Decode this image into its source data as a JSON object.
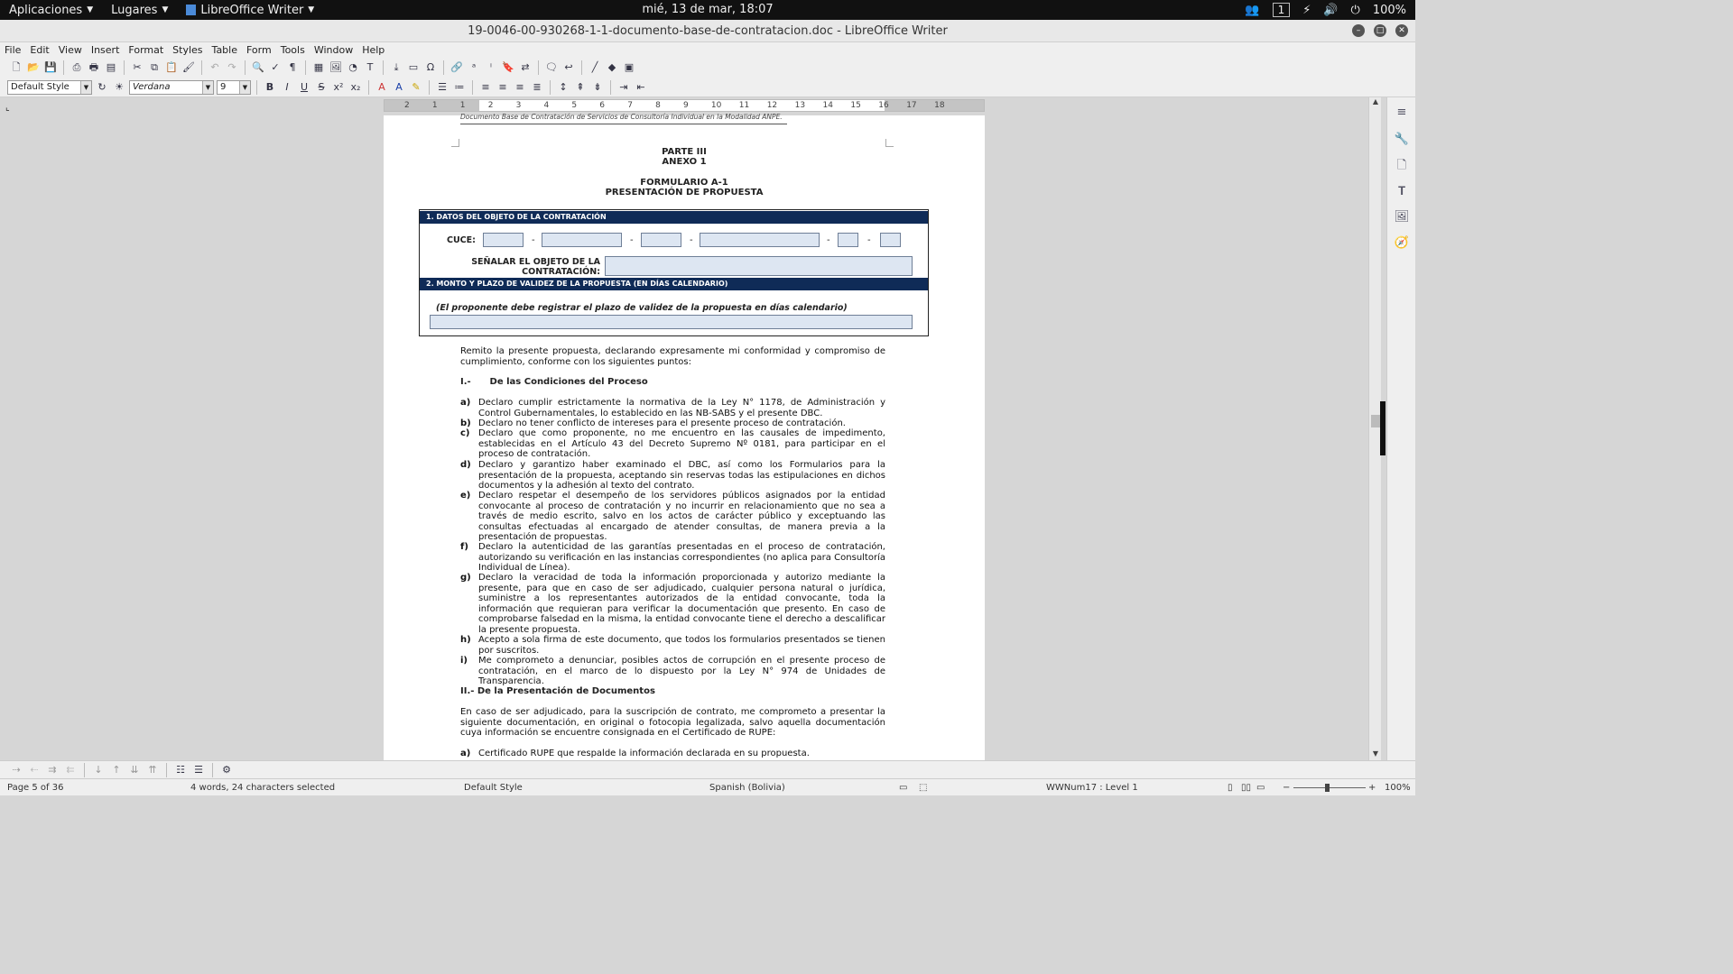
{
  "topbar": {
    "applications": "Aplicaciones",
    "places": "Lugares",
    "active_app": "LibreOffice Writer",
    "clock": "mié, 13 de mar, 18:07",
    "workspace": "1",
    "battery": "100%"
  },
  "window": {
    "title": "19-0046-00-930268-1-1-documento-base-de-contratacion.doc - LibreOffice Writer"
  },
  "menubar": [
    "File",
    "Edit",
    "View",
    "Insert",
    "Format",
    "Styles",
    "Table",
    "Form",
    "Tools",
    "Window",
    "Help"
  ],
  "formatting": {
    "paragraph_style": "Default Style",
    "font_name": "Verdana",
    "font_size": "9"
  },
  "ruler": [
    "2",
    "1",
    "1",
    "2",
    "3",
    "4",
    "5",
    "6",
    "7",
    "8",
    "9",
    "10",
    "11",
    "12",
    "13",
    "14",
    "15",
    "16",
    "17",
    "18"
  ],
  "document": {
    "header": "Documento Base de Contratación de Servicios de Consultoría Individual en la Modalidad ANPE.",
    "parte": "PARTE III",
    "anexo": "ANEXO 1",
    "formulario": "FORMULARIO A-1",
    "presentacion": "PRESENTACIÓN DE PROPUESTA",
    "form": {
      "section1": "1.   DATOS DEL OBJETO DE LA CONTRATACIÓN",
      "cuce_label": "CUCE:",
      "dash": "-",
      "senalar_label": "SEÑALAR EL OBJETO DE LA CONTRATACIÓN:",
      "section2": "2.   MONTO Y PLAZO DE VALIDEZ DE LA PROPUESTA (EN DÍAS CALENDARIO)",
      "note": "(El proponente debe registrar el plazo de validez de la propuesta en días calendario)"
    },
    "intro": "Remito la presente propuesta, declarando expresamente mi conformidad y compromiso de cumplimiento, conforme con los siguientes puntos:",
    "section_I": "I.-      De las Condiciones del Proceso",
    "items_I": [
      {
        "letter": "a)",
        "text": "Declaro cumplir estrictamente la normativa de la Ley N° 1178, de Administración y Control Gubernamentales, lo establecido en las NB-SABS y el presente DBC."
      },
      {
        "letter": "b)",
        "text": "Declaro no tener conflicto de intereses para el presente proceso de contratación."
      },
      {
        "letter": "c)",
        "text": "Declaro que como proponente, no me encuentro en las causales de impedimento, establecidas en el Artículo 43 del Decreto Supremo Nº 0181, para participar en el proceso de contratación."
      },
      {
        "letter": "d)",
        "text": "Declaro y garantizo haber examinado el DBC, así como los Formularios para la presentación de la propuesta, aceptando sin reservas todas las estipulaciones en dichos documentos y la adhesión al texto del contrato."
      },
      {
        "letter": "e)",
        "text": "Declaro respetar el desempeño de los servidores públicos asignados por la entidad convocante al proceso de contratación y no incurrir en relacionamiento que no sea a través de medio escrito, salvo en los actos de carácter público y exceptuando las consultas efectuadas al encargado de atender consultas, de manera previa a la presentación de propuestas."
      },
      {
        "letter": "f)",
        "text": "Declaro la autenticidad de las garantías presentadas en el proceso de contratación, autorizando su verificación en las instancias correspondientes (no aplica para Consultoría Individual de Línea)."
      },
      {
        "letter": "g)",
        "text": "Declaro la veracidad de toda la información proporcionada y autorizo mediante la presente, para que en caso de ser adjudicado, cualquier persona natural o jurídica, suministre a los representantes autorizados de la entidad convocante, toda la información que requieran para verificar la documentación que presento. En caso de comprobarse falsedad en la misma, la entidad convocante tiene el derecho a descalificar la presente propuesta."
      },
      {
        "letter": "h)",
        "text": "Acepto a sola firma de este documento, que todos los formularios presentados se tienen por suscritos."
      },
      {
        "letter": "i)",
        "text": "Me comprometo a denunciar, posibles actos de corrupción en el presente proceso de contratación, en el marco de lo dispuesto por la Ley N° 974 de Unidades de Transparencia."
      }
    ],
    "section_II": "II.- De la Presentación de Documentos",
    "para_II": "En caso de ser adjudicado, para la suscripción de contrato, me comprometo a presentar la siguiente documentación, en original o fotocopia legalizada, salvo aquella documentación cuya información se encuentre consignada en el Certificado de RUPE:",
    "items_II": [
      {
        "letter": "a)",
        "text": "Certificado RUPE que respalde la información declarada en su propuesta."
      }
    ]
  },
  "statusbar": {
    "page": "Page 5 of 36",
    "selection": "4 words, 24 characters selected",
    "style": "Default Style",
    "language": "Spanish (Bolivia)",
    "list_level": "WWNum17 : Level 1",
    "zoom": "100%"
  }
}
